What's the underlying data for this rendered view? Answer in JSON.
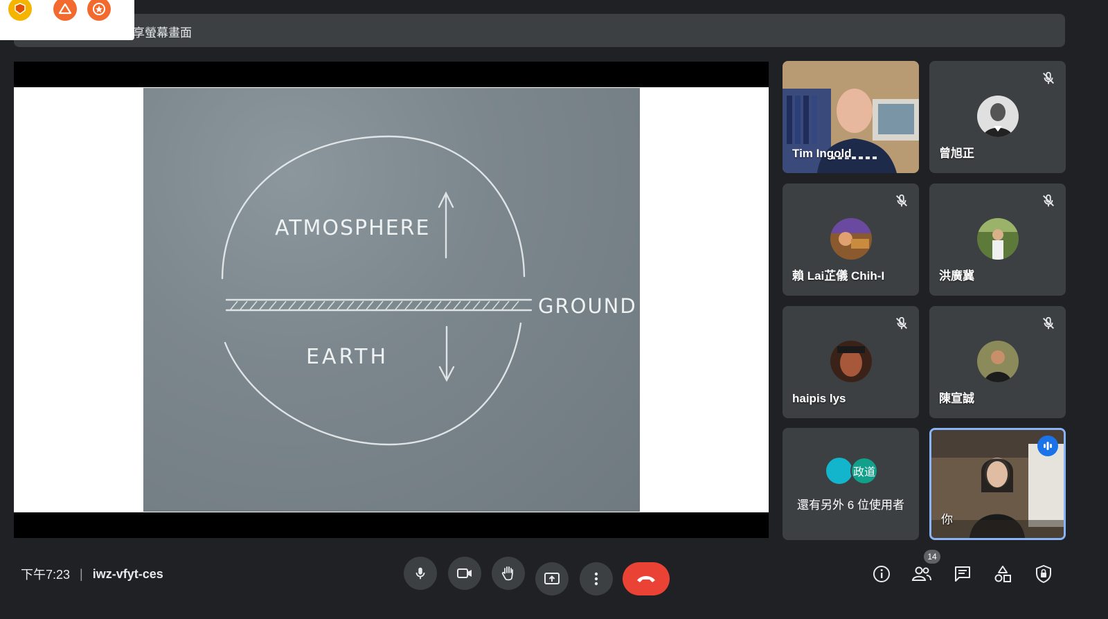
{
  "banner": {
    "text": "享螢幕畫面"
  },
  "corner_icons": [
    "badge-icon",
    "warning-icon",
    "star-icon"
  ],
  "slide": {
    "words": {
      "top": "ATMOSPHERE",
      "middle": "GROUND",
      "bottom": "EARTH"
    }
  },
  "participants": [
    {
      "name": "Tim Ingold",
      "muted": false,
      "video": true
    },
    {
      "name": "曾旭正",
      "muted": true
    },
    {
      "name": "賴 Lai芷儀 Chih-I",
      "muted": true
    },
    {
      "name": "洪廣冀",
      "muted": true
    },
    {
      "name": "haipis lys",
      "muted": true
    },
    {
      "name": "陳宣誠",
      "muted": true
    }
  ],
  "more_tile": {
    "avatar_label": "政道",
    "label": "還有另外 6 位使用者"
  },
  "self_tile": {
    "label": "你"
  },
  "bottom": {
    "time": "下午7:23",
    "separator": "|",
    "meeting_code": "iwz-vfyt-ces",
    "people_count": "14"
  },
  "colors": {
    "background": "#202124",
    "tile": "#3c4043",
    "end_call": "#ea4335",
    "accent": "#8ab4f8"
  }
}
